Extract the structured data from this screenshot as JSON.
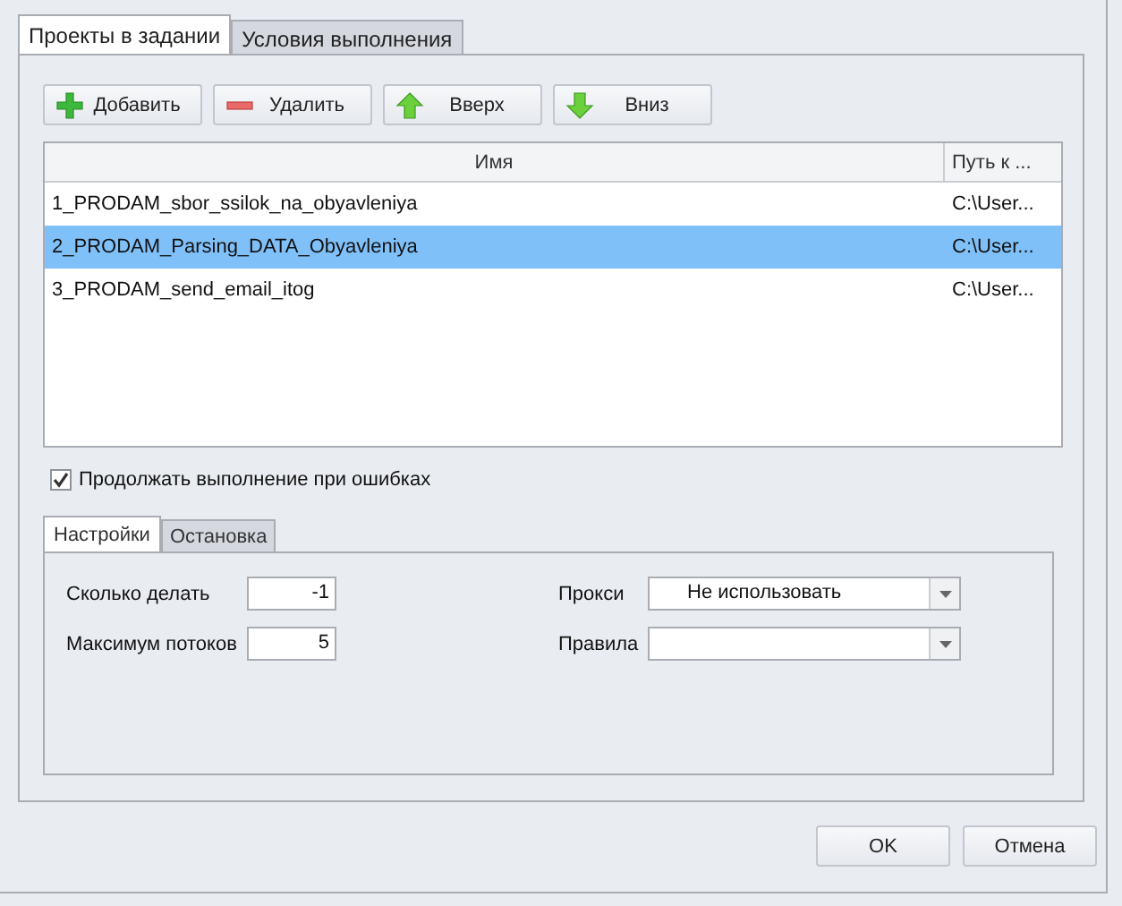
{
  "tabs": [
    {
      "label": "Проекты в задании",
      "selected": true
    },
    {
      "label": "Условия выполнения",
      "selected": false
    }
  ],
  "toolbar": [
    {
      "label": "Добавить",
      "kind": "add"
    },
    {
      "label": "Удалить",
      "kind": "remove"
    },
    {
      "label": "Вверх",
      "kind": "up"
    },
    {
      "label": "Вниз",
      "kind": "down"
    }
  ],
  "table": {
    "columns": [
      "Имя",
      "Путь к ..."
    ],
    "rows": [
      {
        "cells": [
          "1_PRODAM_sbor_ssilok_na_obyavleniya",
          "C:\\User..."
        ],
        "selected": false
      },
      {
        "cells": [
          "2_PRODAM_Parsing_DATA_Obyavleniya",
          "C:\\User..."
        ],
        "selected": true
      },
      {
        "cells": [
          "3_PRODAM_send_email_itog",
          "C:\\User..."
        ],
        "selected": false
      }
    ]
  },
  "continue_on_errors": {
    "label": "Продолжать выполнение при ошибках",
    "checked": true
  },
  "inner_tabs": [
    {
      "label": "Настройки",
      "selected": true
    },
    {
      "label": "Остановка",
      "selected": false
    }
  ],
  "fields": [
    {
      "label": "Сколько делать",
      "kind": "number",
      "value": "-1"
    },
    {
      "label": "Прокси",
      "kind": "combo",
      "value": "Не использовать"
    },
    {
      "label": "Максимум потоков",
      "kind": "number",
      "value": "5"
    },
    {
      "label": "Правила",
      "kind": "combo"
    }
  ],
  "buttons": [
    "OK",
    "Отмена"
  ]
}
